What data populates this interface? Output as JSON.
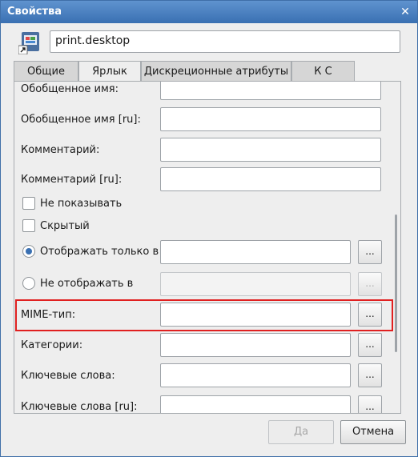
{
  "window": {
    "title": "Свойства",
    "close_glyph": "✕"
  },
  "file": {
    "name": "print.desktop",
    "icon": "desktop-shortcut-icon"
  },
  "tabs": [
    {
      "label": "Общие"
    },
    {
      "label": "Ярлык"
    },
    {
      "label": "Дискреционные атрибуты"
    },
    {
      "label": "К С"
    }
  ],
  "fields": {
    "generic_name": "Обобщенное имя:",
    "generic_name_ru": "Обобщенное имя [ru]:",
    "comment": "Комментарий:",
    "comment_ru": "Комментарий [ru]:",
    "hide": "Не показывать",
    "hidden": "Скрытый",
    "only_show_in": "Отображать только в",
    "not_show_in": "Не отображать в",
    "mime": "MIME-тип:",
    "categories": "Категории:",
    "keywords": "Ключевые слова:",
    "keywords_ru": "Ключевые слова [ru]:",
    "browse": "..."
  },
  "buttons": {
    "ok": "Да",
    "cancel": "Отмена"
  },
  "colors": {
    "titlebar": "#3a70b2",
    "highlight": "#e02020"
  }
}
